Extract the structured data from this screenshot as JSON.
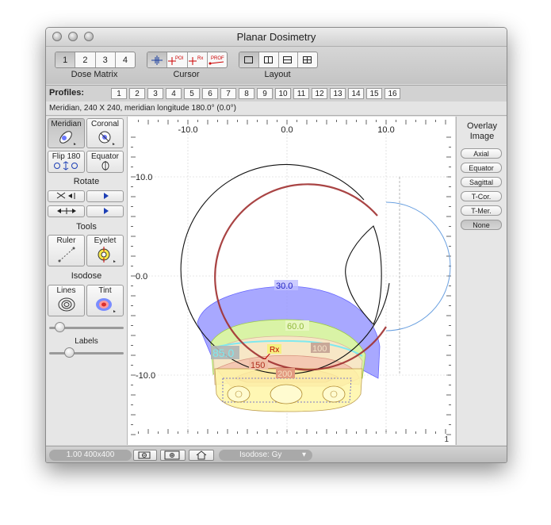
{
  "window": {
    "title": "Planar Dosimetry"
  },
  "toolbar": {
    "dose_matrix": {
      "label": "Dose Matrix",
      "options": [
        "1",
        "2",
        "3",
        "4"
      ],
      "selected": "1"
    },
    "cursor": {
      "label": "Cursor",
      "tools": [
        "crosshair",
        "POI",
        "Rx",
        "PROF"
      ],
      "selected": "crosshair"
    },
    "layout": {
      "label": "Layout",
      "options": [
        "single",
        "two-vertical",
        "two-horizontal",
        "quad"
      ],
      "selected": "single"
    }
  },
  "profiles": {
    "label": "Profiles:",
    "items": [
      "1",
      "2",
      "3",
      "4",
      "5",
      "6",
      "7",
      "8",
      "9",
      "10",
      "11",
      "12",
      "13",
      "14",
      "15",
      "16"
    ]
  },
  "status": {
    "text": "Meridian, 240 X 240, meridian longitude 180.0° (0.0°)"
  },
  "left_panel": {
    "meridian": "Meridian",
    "coronal": "Coronal",
    "flip": "Flip 180",
    "equator": "Equator",
    "rotate": "Rotate",
    "tools": "Tools",
    "ruler": "Ruler",
    "eyelet": "Eyelet",
    "isodose": "Isodose",
    "lines": "Lines",
    "tint": "Tint",
    "labels": "Labels"
  },
  "plot": {
    "x_ticks": [
      "-10.0",
      "0.0",
      "10.0"
    ],
    "y_ticks": [
      "10.0",
      "0.0",
      "-10.0"
    ],
    "isodose_labels": [
      "30.0",
      "60.0",
      "85.0",
      "100",
      "150",
      "200"
    ],
    "rx_label": "Rx",
    "page_number": "1"
  },
  "overlay": {
    "title_line1": "Overlay",
    "title_line2": "Image",
    "options": [
      "Axial",
      "Equator",
      "Sagittal",
      "T-Cor.",
      "T-Mer.",
      "None"
    ],
    "selected": "None"
  },
  "bottom": {
    "zoom": "1.00 400x400",
    "isodose_menu": "Isodose: Gy"
  }
}
